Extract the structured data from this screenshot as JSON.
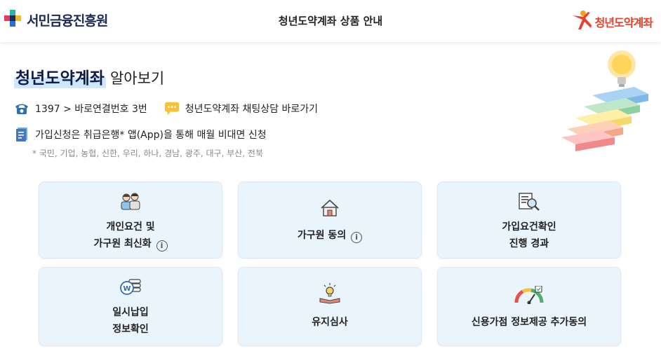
{
  "header": {
    "left_brand": "서민금융진흥원",
    "title": "청년도약계좌 상품 안내",
    "right_brand": "청년도약계좌"
  },
  "intro": {
    "heading_strong": "청년도약계좌",
    "heading_rest": "알아보기",
    "phone_text": "1397 > 바로연결번호 3번",
    "chat_text": "청년도약계좌 채팅상담 바로가기",
    "apply_text": "가입신청은 취급은행* 앱(App)을 통해 매월 비대면 신청",
    "banks_note": "* 국민, 기업, 농협, 신한, 우리, 하나, 경남, 광주, 대구, 부산, 전북"
  },
  "cards": [
    {
      "line1": "개인요건 및",
      "line2": "가구원 최신화",
      "info": "i",
      "icon": "family-icon"
    },
    {
      "line1": "가구원 동의",
      "info": "i",
      "icon": "house-icon"
    },
    {
      "line1": "가입요건확인",
      "line2": "진행 경과",
      "icon": "document-search-icon"
    },
    {
      "line1": "일시납입",
      "line2": "정보확인",
      "icon": "coin-stack-icon"
    },
    {
      "line1": "유지심사",
      "icon": "lightbulb-book-icon"
    },
    {
      "line1": "신용가점 정보제공 추가동의",
      "icon": "gauge-icon"
    }
  ],
  "colors": {
    "card_bg": "#eaf4fd",
    "heading_highlight": "#cfe6ff",
    "brand_red": "#e8402a",
    "brand_navy": "#1a2a55"
  }
}
